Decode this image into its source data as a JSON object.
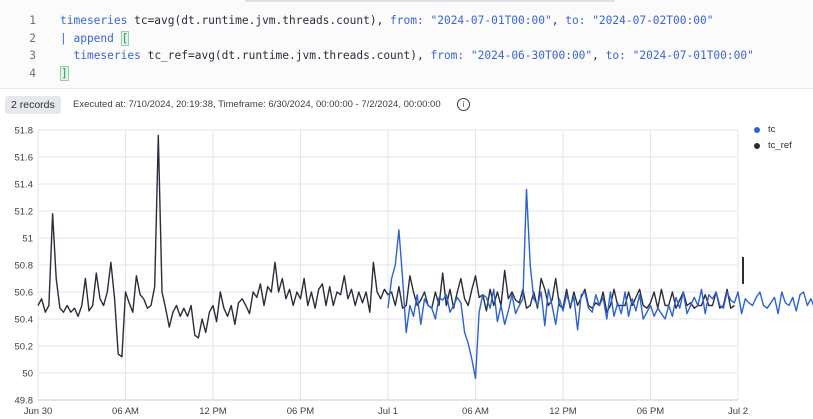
{
  "editor": {
    "lines": [
      {
        "num": "1",
        "parts": [
          [
            "kw",
            "timeseries"
          ],
          [
            "txt",
            " tc=avg(dt.runtime.jvm.threads.count), "
          ],
          [
            "kw",
            "from:"
          ],
          [
            "txt",
            " "
          ],
          [
            "str",
            "\"2024-07-01T00:00\""
          ],
          [
            "txt",
            ", "
          ],
          [
            "kw",
            "to:"
          ],
          [
            "txt",
            " "
          ],
          [
            "str",
            "\"2024-07-02T00:00\""
          ]
        ]
      },
      {
        "num": "2",
        "parts": [
          [
            "kw",
            "| append "
          ],
          [
            "br",
            "["
          ]
        ]
      },
      {
        "num": "3",
        "parts": [
          [
            "txt",
            "  "
          ],
          [
            "kw",
            "timeseries"
          ],
          [
            "txt",
            " tc_ref=avg(dt.runtime.jvm.threads.count), "
          ],
          [
            "kw",
            "from:"
          ],
          [
            "txt",
            " "
          ],
          [
            "str",
            "\"2024-06-30T00:00\""
          ],
          [
            "txt",
            ", "
          ],
          [
            "kw",
            "to:"
          ],
          [
            "txt",
            " "
          ],
          [
            "str",
            "\"2024-07-01T00:00\""
          ]
        ]
      },
      {
        "num": "4",
        "parts": [
          [
            "br",
            "]"
          ]
        ]
      }
    ]
  },
  "result": {
    "records_label": "2 records",
    "executed_text": "Executed at: 7/10/2024, 20:19:38, Timeframe: 6/30/2024, 00:00:00 - 7/2/2024, 00:00:00",
    "info_glyph": "i"
  },
  "colors": {
    "tc": "#2d62d2",
    "tc_ref": "#2a2c3a",
    "grid": "#e4e5e9"
  },
  "chart_data": {
    "type": "line",
    "x_tick_labels": [
      "Jun 30",
      "06 AM",
      "12 PM",
      "06 PM",
      "Jul 1",
      "06 AM",
      "12 PM",
      "06 PM",
      "Jul 2"
    ],
    "x_range_hours": [
      0,
      48
    ],
    "ylim": [
      49.8,
      51.8
    ],
    "y_ticks": [
      49.8,
      50,
      50.2,
      50.4,
      50.6,
      50.8,
      51,
      51.2,
      51.4,
      51.6,
      51.8
    ],
    "y_tick_labels": [
      "49.8",
      "50",
      "50.2",
      "50.4",
      "50.6",
      "50.8",
      "51",
      "51.2",
      "51.4",
      "51.6",
      "51.8"
    ],
    "grid": true,
    "legend_position": "top-right",
    "series": [
      {
        "name": "tc_ref",
        "start_hour": 0,
        "step_hours": 0.25,
        "values": [
          50.5,
          50.55,
          50.45,
          50.5,
          51.18,
          50.7,
          50.48,
          50.45,
          50.5,
          50.45,
          50.48,
          50.42,
          50.5,
          50.7,
          50.46,
          50.5,
          50.74,
          50.55,
          50.5,
          50.6,
          50.82,
          50.55,
          50.14,
          50.12,
          50.6,
          50.52,
          50.45,
          50.72,
          50.58,
          50.55,
          50.48,
          50.5,
          50.64,
          51.76,
          50.6,
          50.48,
          50.34,
          50.45,
          50.5,
          50.42,
          50.48,
          50.42,
          50.5,
          50.28,
          50.26,
          50.4,
          50.3,
          50.45,
          50.5,
          50.38,
          50.6,
          50.48,
          50.42,
          50.5,
          50.36,
          50.52,
          50.55,
          50.5,
          50.44,
          50.6,
          50.56,
          50.66,
          50.5,
          50.64,
          50.6,
          50.82,
          50.6,
          50.7,
          50.55,
          50.62,
          50.5,
          50.6,
          50.55,
          50.7,
          50.5,
          50.6,
          50.48,
          50.62,
          50.66,
          50.5,
          50.64,
          50.5,
          50.6,
          50.58,
          50.72,
          50.55,
          50.62,
          50.5,
          50.6,
          50.52,
          50.6,
          50.45,
          50.82,
          50.6,
          50.55,
          50.62,
          50.58,
          50.6,
          50.5,
          50.64,
          50.48,
          50.5,
          50.72,
          50.6,
          50.5,
          50.54,
          50.6,
          50.5,
          50.48,
          50.6,
          50.5,
          50.74,
          50.5,
          50.62,
          50.48,
          50.6,
          50.7,
          50.55,
          50.5,
          50.62,
          50.72,
          50.56,
          50.58,
          50.46,
          50.62,
          50.5,
          50.6,
          50.5,
          50.76,
          50.55,
          50.6,
          50.54,
          50.52,
          50.62,
          50.48,
          50.5,
          50.6,
          50.48,
          50.7,
          50.62,
          50.5,
          50.54,
          50.7,
          50.5,
          50.48,
          50.62,
          50.48,
          50.6,
          50.5,
          50.56,
          50.62,
          50.5,
          50.48,
          50.52,
          50.5,
          50.6,
          50.45,
          50.5,
          50.62,
          50.5,
          50.5,
          50.5,
          50.6,
          50.5,
          50.56,
          50.62,
          50.5,
          50.48,
          50.52,
          50.6,
          50.48,
          50.62,
          50.5,
          50.5,
          50.6,
          50.48,
          50.54,
          50.6,
          50.5,
          50.52,
          50.48,
          50.5,
          50.5,
          50.58,
          50.5,
          50.5,
          50.6,
          50.48,
          50.5,
          50.62,
          50.48,
          50.5
        ]
      },
      {
        "name": "tc",
        "start_hour": 24,
        "step_hours": 0.25,
        "values": [
          50.48,
          50.7,
          50.8,
          51.06,
          50.7,
          50.3,
          50.5,
          50.42,
          50.58,
          50.36,
          50.55,
          50.5,
          50.48,
          50.4,
          50.56,
          50.54,
          50.58,
          50.45,
          50.5,
          50.56,
          50.52,
          50.3,
          50.22,
          50.1,
          49.96,
          50.45,
          50.58,
          50.56,
          50.48,
          50.62,
          50.38,
          50.5,
          50.36,
          50.46,
          50.58,
          50.44,
          50.5,
          50.55,
          51.36,
          50.8,
          50.55,
          50.5,
          50.6,
          50.35,
          50.62,
          50.5,
          50.36,
          50.55,
          50.46,
          50.58,
          50.5,
          50.56,
          50.32,
          50.58,
          50.6,
          50.48,
          50.45,
          50.58,
          50.5,
          50.56,
          50.4,
          50.6,
          50.42,
          50.52,
          50.44,
          50.6,
          50.42,
          50.55,
          50.46,
          50.58,
          50.4,
          50.45,
          50.5,
          50.42,
          50.48,
          50.44,
          50.4,
          50.5,
          50.42,
          50.56,
          50.48,
          50.6,
          50.44,
          50.5,
          50.56,
          50.5,
          50.62,
          50.44,
          50.58,
          50.55,
          50.6,
          50.5,
          50.48,
          50.6,
          50.54,
          50.52,
          50.6,
          50.44,
          50.55,
          50.52,
          50.5,
          50.56,
          50.6,
          50.5,
          50.48,
          50.52,
          50.56,
          50.44,
          50.6,
          50.52,
          50.5,
          50.56,
          50.46,
          50.58,
          50.6,
          50.5,
          50.55,
          50.48,
          50.62,
          50.55,
          50.5,
          50.6,
          50.52,
          50.5,
          50.58,
          50.44,
          50.6,
          50.5,
          50.62,
          50.48,
          50.55,
          50.5,
          50.6,
          50.46,
          50.58,
          50.52,
          50.6,
          50.48,
          50.56,
          50.62,
          50.5,
          50.52,
          50.6,
          50.46,
          50.56,
          50.5,
          50.66,
          50.5,
          50.56,
          50.46,
          50.6,
          50.52,
          50.64,
          50.54,
          50.48,
          50.6,
          50.5,
          50.62,
          50.66,
          50.5,
          50.58,
          50.68,
          50.52,
          50.6,
          50.48,
          50.62,
          50.72,
          50.5,
          50.55,
          50.6,
          50.66,
          50.5,
          50.6,
          50.62,
          50.58,
          50.7,
          50.56,
          50.6,
          50.5,
          50.68,
          50.48,
          50.6,
          50.7,
          50.52,
          50.62,
          50.6,
          50.68,
          50.58,
          50.5,
          50.76,
          50.7,
          50.6,
          50.54
        ]
      }
    ]
  }
}
